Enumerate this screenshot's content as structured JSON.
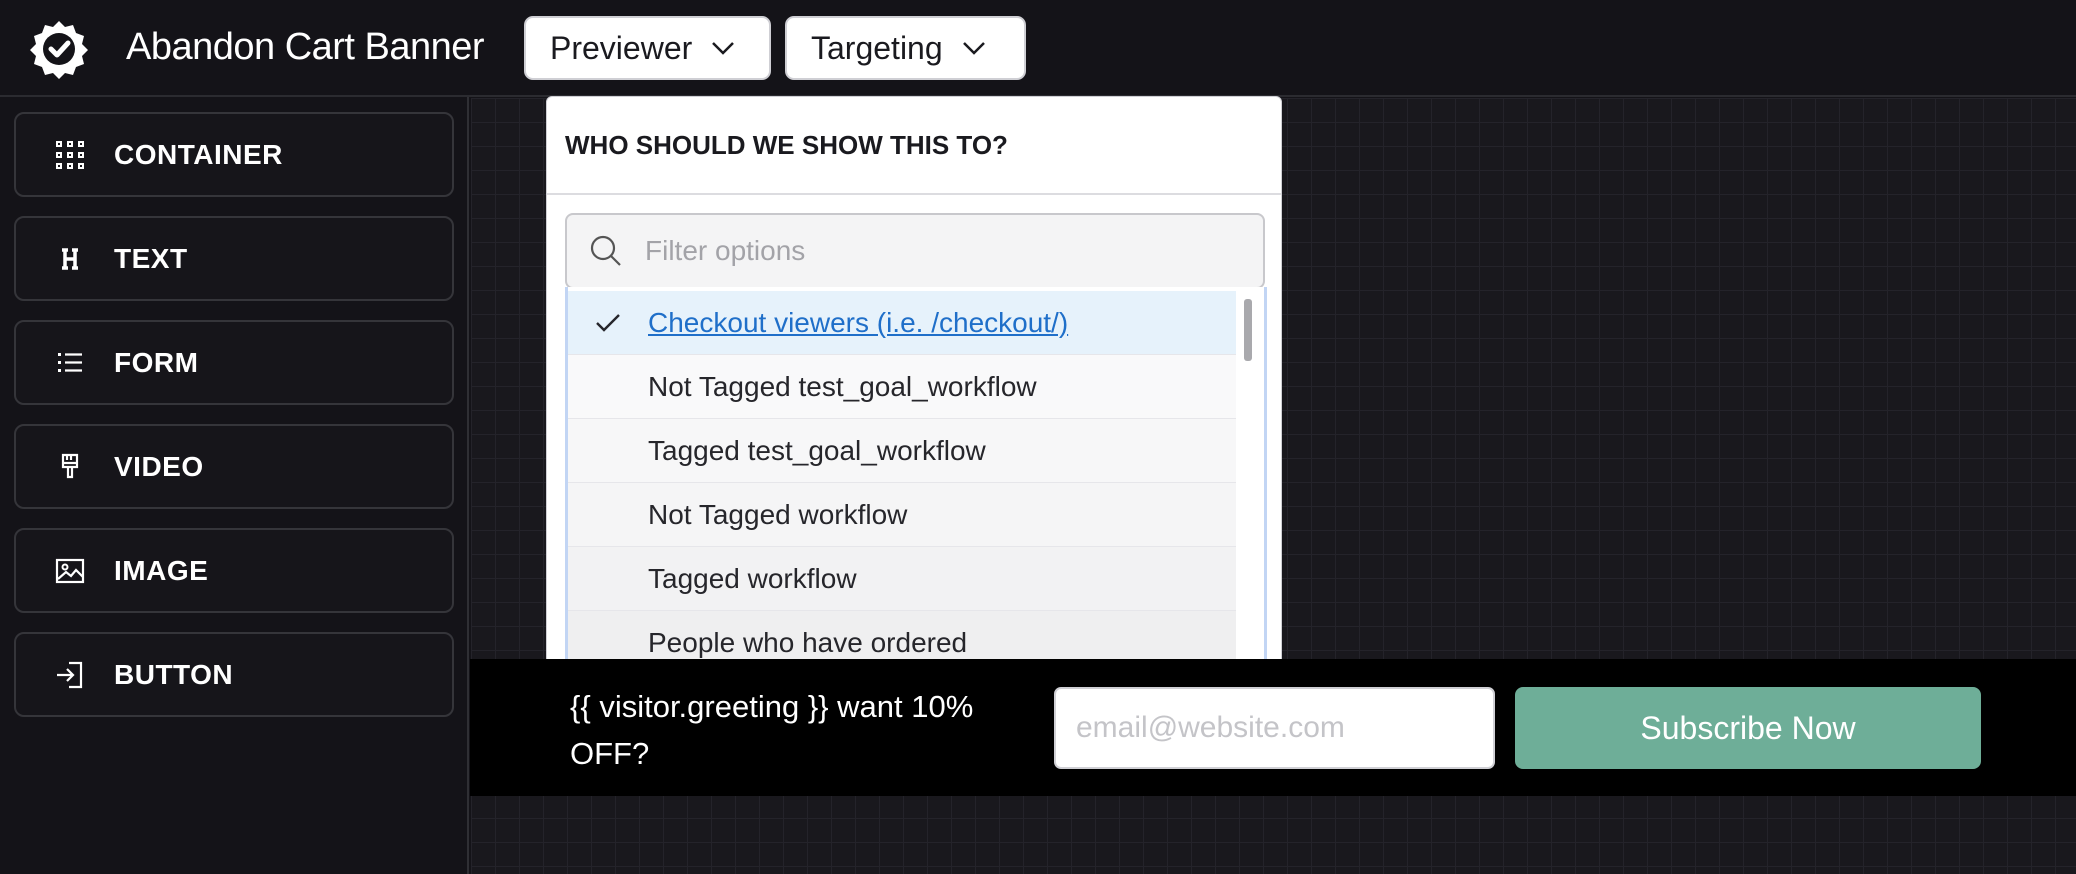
{
  "app": {
    "title": "Abandon Cart Banner",
    "logo_icon": "gear-check-icon"
  },
  "toolbar": {
    "previewer_label": "Previewer",
    "targeting_label": "Targeting"
  },
  "sidebar": {
    "items": [
      {
        "label": "CONTAINER",
        "icon": "grid-icon"
      },
      {
        "label": "TEXT",
        "icon": "heading-icon"
      },
      {
        "label": "FORM",
        "icon": "list-icon"
      },
      {
        "label": "VIDEO",
        "icon": "brush-icon"
      },
      {
        "label": "IMAGE",
        "icon": "image-icon"
      },
      {
        "label": "BUTTON",
        "icon": "sign-in-icon"
      }
    ]
  },
  "targeting": {
    "heading": "WHO SHOULD WE SHOW THIS TO?",
    "filter_placeholder": "Filter options",
    "options": [
      {
        "label": "Checkout viewers (i.e. /checkout/)",
        "selected": true
      },
      {
        "label": "Not Tagged test_goal_workflow",
        "selected": false
      },
      {
        "label": "Tagged test_goal_workflow",
        "selected": false
      },
      {
        "label": "Not Tagged workflow",
        "selected": false
      },
      {
        "label": "Tagged workflow",
        "selected": false
      },
      {
        "label": "People who have ordered",
        "selected": false
      }
    ]
  },
  "banner": {
    "message": "{{ visitor.greeting }} want 10% OFF?",
    "email_placeholder": "email@website.com",
    "subscribe_label": "Subscribe Now"
  },
  "colors": {
    "background": "#141318",
    "subscribe_button": "#6eae98",
    "selected_option_text": "#1f6fc9",
    "selected_option_bg": "#e6f2fb"
  }
}
